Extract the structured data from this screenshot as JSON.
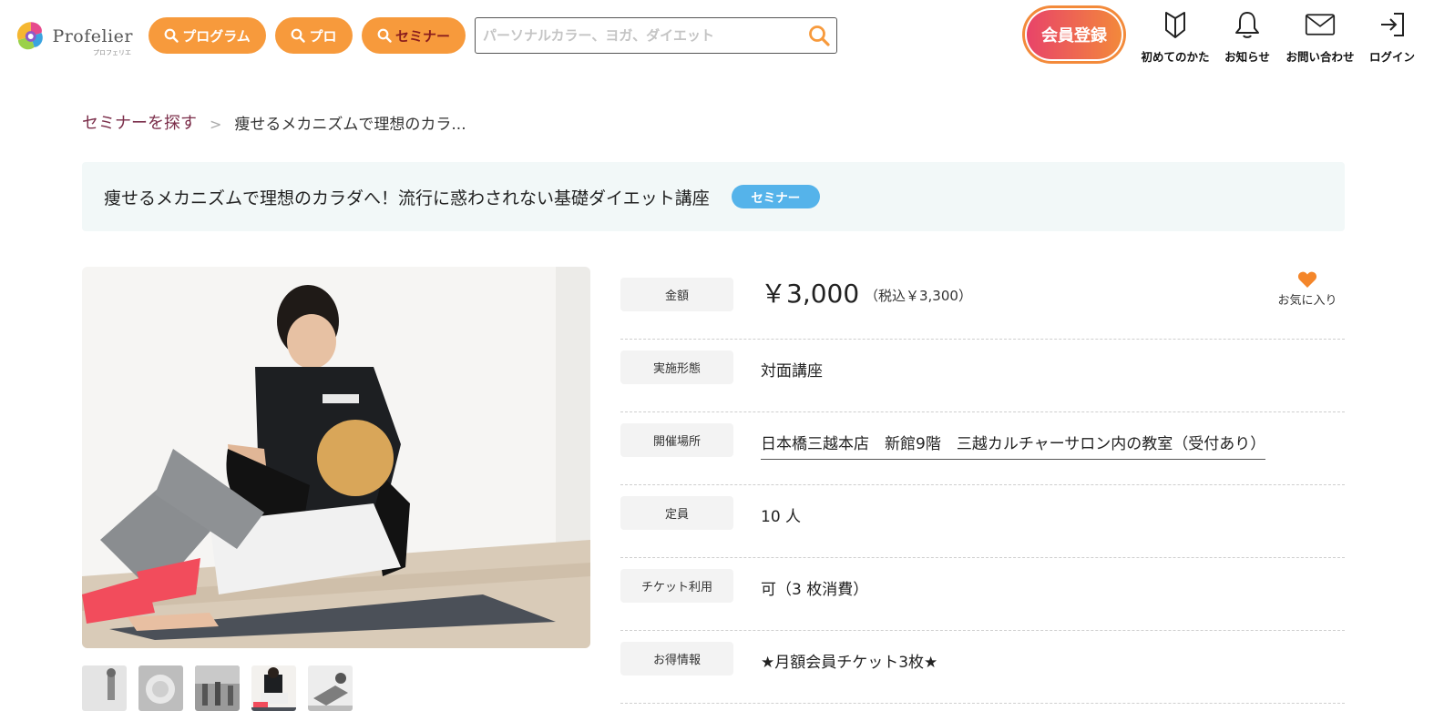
{
  "header": {
    "logo_text": "Profelier",
    "logo_subtext": "プロフェリエ",
    "pills": {
      "program": "プログラム",
      "pro": "プロ",
      "seminar": "セミナー"
    },
    "search": {
      "placeholder": "パーソナルカラー、ヨガ、ダイエット",
      "value": ""
    },
    "register_label": "会員登録",
    "nav": {
      "first_time": "初めてのかた",
      "notices": "お知らせ",
      "contact": "お問い合わせ",
      "login": "ログイン"
    }
  },
  "breadcrumb": {
    "parent": "セミナーを探す",
    "separator": ">",
    "current": "痩せるメカニズムで理想のカラ..."
  },
  "title": {
    "text": "痩せるメカニズムで理想のカラダへ！流行に惑わされない基礎ダイエット講座",
    "badge": "セミナー"
  },
  "details": {
    "price": {
      "label": "金額",
      "main": "￥3,000",
      "tax": "（税込￥3,300）"
    },
    "favorite_label": "お気に入り",
    "format": {
      "label": "実施形態",
      "value": "対面講座"
    },
    "venue": {
      "label": "開催場所",
      "value": "日本橋三越本店　新館9階　三越カルチャーサロン内の教室（受付あり）"
    },
    "capacity": {
      "label": "定員",
      "value": "10 人"
    },
    "ticket": {
      "label": "チケット利用",
      "value": "可（3 枚消費）"
    },
    "deal": {
      "label": "お得情報",
      "value": "★月額会員チケット3枚★"
    }
  },
  "colors": {
    "accent_orange": "#f79a3c",
    "badge_blue": "#55b3ea",
    "breadcrumb_link": "#7b2e4a",
    "title_bg": "#f2f8f8"
  },
  "icons": [
    "search-icon",
    "beginner-mark-icon",
    "bell-icon",
    "envelope-icon",
    "login-icon",
    "heart-icon"
  ]
}
